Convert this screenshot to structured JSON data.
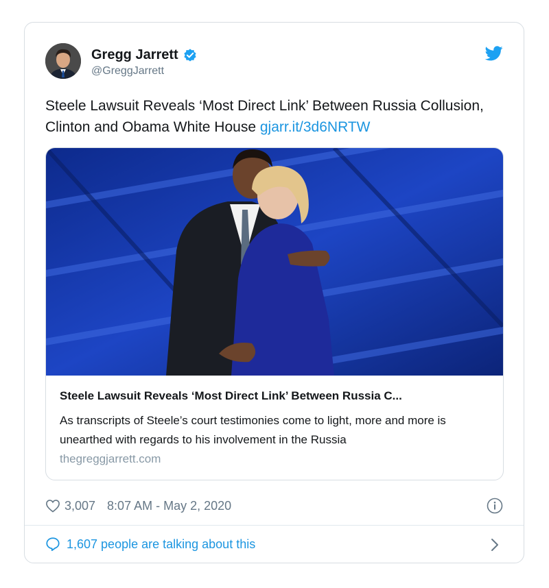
{
  "author": {
    "name": "Gregg Jarrett",
    "handle": "@GreggJarrett"
  },
  "tweet": {
    "text": "Steele Lawsuit Reveals ‘Most Direct Link’ Between Russia Collusion, Clinton and Obama White House",
    "link": "gjarr.it/3d6NRTW"
  },
  "card": {
    "title": "Steele Lawsuit Reveals ‘Most Direct Link’ Between Russia C...",
    "description": "As transcripts of Steele’s court testimonies come to light, more and more is unearthed with regards to his involvement in the Russia",
    "domain": "thegreggjarrett.com"
  },
  "meta": {
    "likes": "3,007",
    "timestamp": "8:07 AM - May 2, 2020"
  },
  "footer": {
    "talking": "1,607 people are talking about this"
  },
  "colors": {
    "accent": "#1b95e0",
    "muted": "#657786",
    "border": "#d7dde2",
    "stage_blue": "#1a3aa8"
  },
  "icons": [
    "verified-icon",
    "twitter-bird-icon",
    "heart-icon",
    "info-icon",
    "reply-bubble-icon",
    "chevron-right-icon"
  ]
}
